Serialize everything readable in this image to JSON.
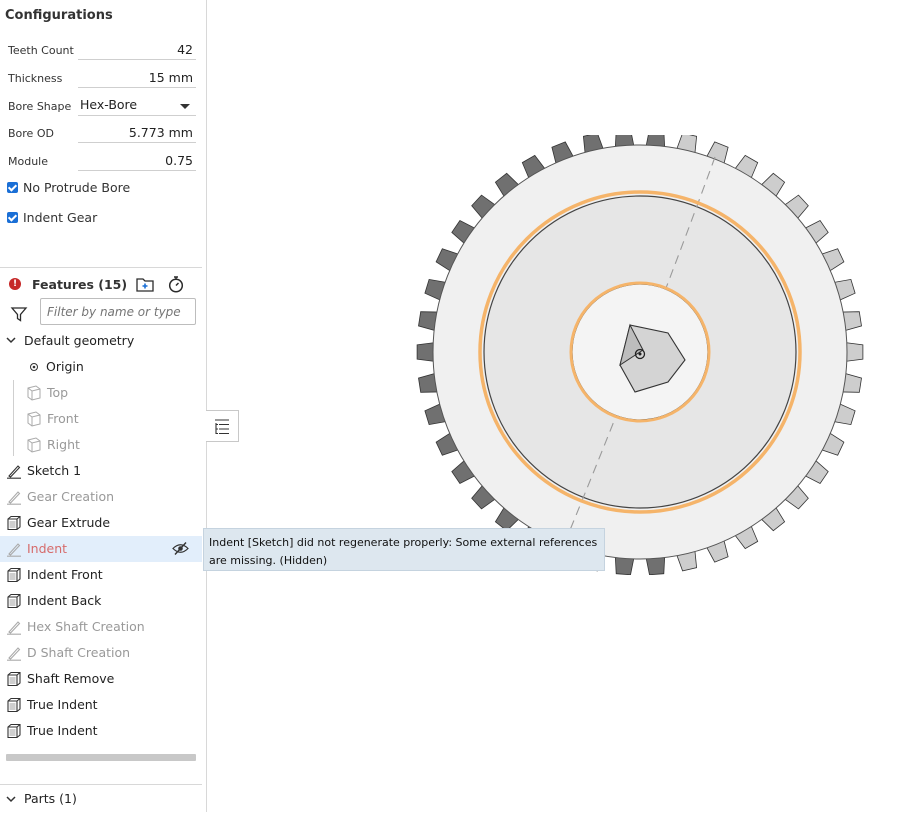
{
  "configurations": {
    "title": "Configurations",
    "fields": [
      {
        "label": "Teeth Count",
        "value": "42"
      },
      {
        "label": "Thickness",
        "value": "15 mm"
      },
      {
        "label": "Bore Shape",
        "value": "Hex-Bore"
      },
      {
        "label": "Bore OD",
        "value": "5.773 mm"
      },
      {
        "label": "Module",
        "value": "0.75"
      }
    ],
    "checkboxes": [
      {
        "label": "No Protrude Bore",
        "checked": true
      },
      {
        "label": "Indent Gear",
        "checked": true
      }
    ]
  },
  "features": {
    "title": "Features (15)",
    "filter_placeholder": "Filter by name or type",
    "default_geometry": "Default geometry",
    "geometry_items": [
      "Origin",
      "Top",
      "Front",
      "Right"
    ],
    "items": [
      {
        "label": "Sketch 1",
        "type": "sketch",
        "state": "normal"
      },
      {
        "label": "Gear Creation",
        "type": "sketch",
        "state": "dim"
      },
      {
        "label": "Gear Extrude",
        "type": "feature",
        "state": "normal"
      },
      {
        "label": "Indent",
        "type": "sketch",
        "state": "error"
      },
      {
        "label": "Indent Front",
        "type": "feature",
        "state": "normal"
      },
      {
        "label": "Indent Back",
        "type": "feature",
        "state": "normal"
      },
      {
        "label": "Hex Shaft Creation",
        "type": "sketch",
        "state": "dim"
      },
      {
        "label": "D Shaft Creation",
        "type": "sketch",
        "state": "dim"
      },
      {
        "label": "Shaft Remove",
        "type": "feature",
        "state": "normal"
      },
      {
        "label": "True Indent",
        "type": "feature",
        "state": "normal"
      },
      {
        "label": "True Indent",
        "type": "feature",
        "state": "normal"
      }
    ]
  },
  "parts": {
    "label": "Parts (1)"
  },
  "tooltip": {
    "text": "Indent [Sketch] did not regenerate properly: Some external references are missing. (Hidden)"
  },
  "colors": {
    "accent": "#1a6fd6",
    "error": "#c62828",
    "highlight": "#f5b46a",
    "selection": "#e2eefb"
  },
  "icons": {
    "error": "error-icon",
    "add_folder": "add-folder-icon",
    "rollback": "stopwatch-icon",
    "filter": "filter-icon",
    "hidden": "eye-slash-icon",
    "tree_toggle": "list-icon"
  }
}
